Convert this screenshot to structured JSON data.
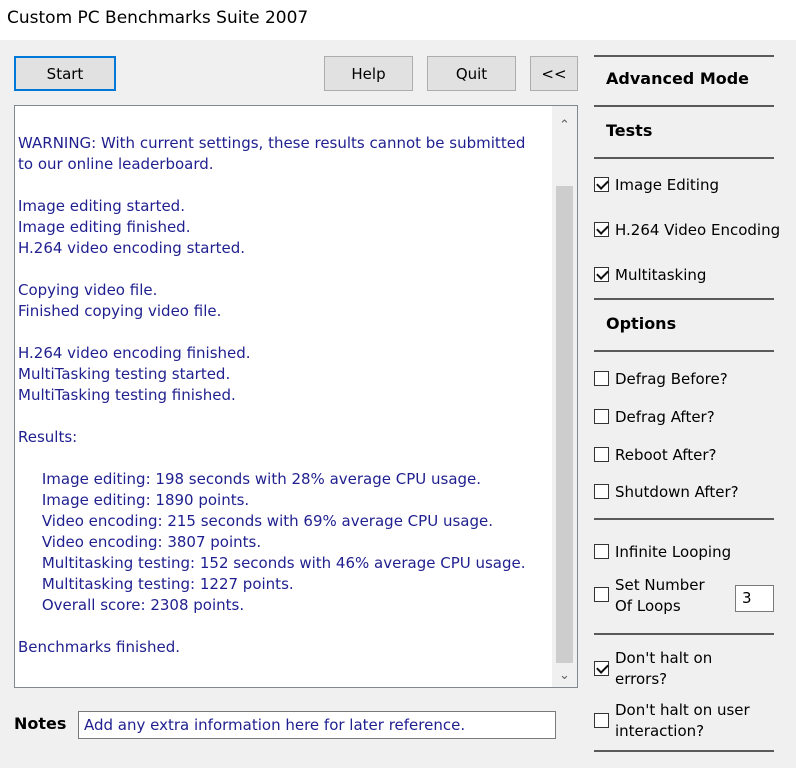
{
  "window": {
    "title": "Custom PC Benchmarks Suite 2007"
  },
  "toolbar": {
    "start": "Start",
    "help": "Help",
    "quit": "Quit",
    "collapse": "<<"
  },
  "log": {
    "lines": "WARNING: With current settings, these results cannot be submitted\nto our online leaderboard.\n\nImage editing started.\nImage editing finished.\nH.264 video encoding started.\n\nCopying video file.\nFinished copying video file.\n\nH.264 video encoding finished.\nMultiTasking testing started.\nMultiTasking testing finished.\n\nResults:\n\n     Image editing: 198 seconds with 28% average CPU usage.\n     Image editing: 1890 points.\n     Video encoding: 215 seconds with 69% average CPU usage.\n     Video encoding: 3807 points.\n     Multitasking testing: 152 seconds with 46% average CPU usage.\n     Multitasking testing: 1227 points.\n     Overall score: 2308 points.\n\nBenchmarks finished.",
    "scroll_up": "⌃",
    "scroll_down": "⌄"
  },
  "panel": {
    "mode_heading": "Advanced Mode",
    "tests_heading": "Tests",
    "tests": [
      {
        "label": "Image Editing",
        "checked": true
      },
      {
        "label": "H.264 Video Encoding",
        "checked": true
      },
      {
        "label": "Multitasking",
        "checked": true
      }
    ],
    "options_heading": "Options",
    "options": [
      {
        "label": "Defrag Before?",
        "checked": false
      },
      {
        "label": "Defrag After?",
        "checked": false
      },
      {
        "label": "Reboot After?",
        "checked": false
      },
      {
        "label": "Shutdown After?",
        "checked": false
      }
    ],
    "infinite_looping": {
      "label": "Infinite Looping",
      "checked": false
    },
    "set_loops": {
      "label_line1": "Set Number",
      "label_line2": "Of Loops",
      "checked": false,
      "value": "3"
    },
    "halt_errors": {
      "label_line1": "Don't halt on",
      "label_line2": "errors?",
      "checked": true
    },
    "halt_user": {
      "label_line1": "Don't halt on user",
      "label_line2": "interaction?",
      "checked": false
    }
  },
  "notes": {
    "label": "Notes",
    "value": "Add any extra information here for later reference."
  }
}
